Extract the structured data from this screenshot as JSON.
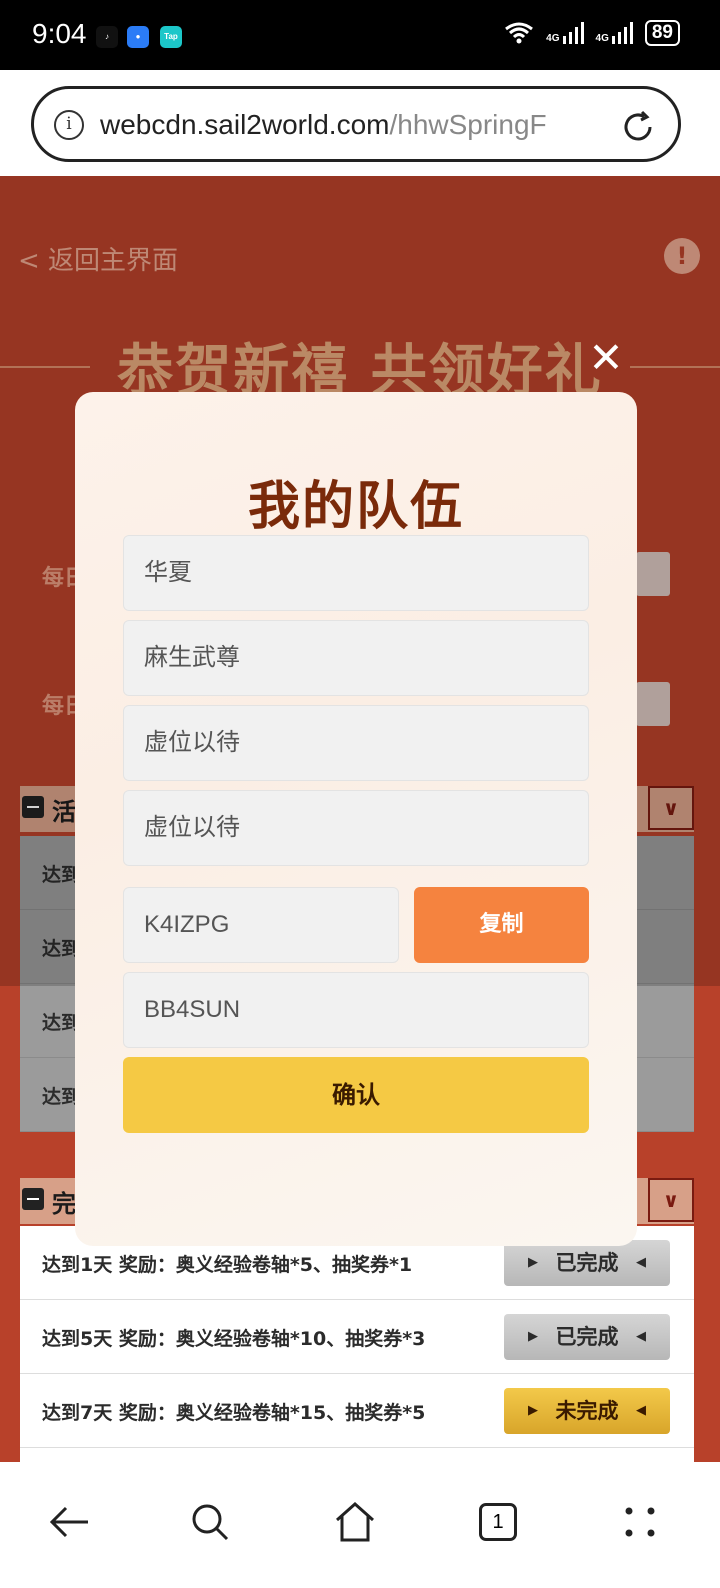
{
  "status_bar": {
    "time": "9:04",
    "apps": [
      {
        "icon": "tiktok-icon",
        "color": "#111111"
      },
      {
        "icon": "message-icon",
        "color": "#2b7cf6"
      },
      {
        "icon": "taptap-icon",
        "color": "#1cc7c9",
        "label": "Tap"
      }
    ],
    "net1": "4G",
    "net2": "4G",
    "battery": "89"
  },
  "browser": {
    "url_main": "webcdn.sail2world.com",
    "url_rest": "/hhwSpringF"
  },
  "page": {
    "back_label": "< 返回主界面",
    "banner": "恭贺新禧 共领好礼",
    "side_rows": [
      "每日",
      "每日"
    ],
    "section1": {
      "title": "活",
      "rows": [
        "达到",
        "达到",
        "达到",
        "达到"
      ]
    },
    "section2": {
      "title": "完",
      "rows": [
        {
          "label": "达到1天   奖励：奥义经验卷轴*5、抽奖券*1",
          "status": "已完成",
          "state": "done"
        },
        {
          "label": "达到5天   奖励：奥义经验卷轴*10、抽奖券*3",
          "status": "已完成",
          "state": "done"
        },
        {
          "label": "达到7天   奖励：奥义经验卷轴*15、抽奖券*5",
          "status": "未完成",
          "state": "pending"
        }
      ]
    }
  },
  "modal": {
    "title": "我的队伍",
    "members": [
      "华夏",
      "麻生武尊",
      "虚位以待",
      "虚位以待"
    ],
    "team_code": "K4IZPG",
    "copy_label": "复制",
    "input_code": "BB4SUN",
    "confirm_label": "确认"
  },
  "nav": {
    "tab_count": "1"
  }
}
